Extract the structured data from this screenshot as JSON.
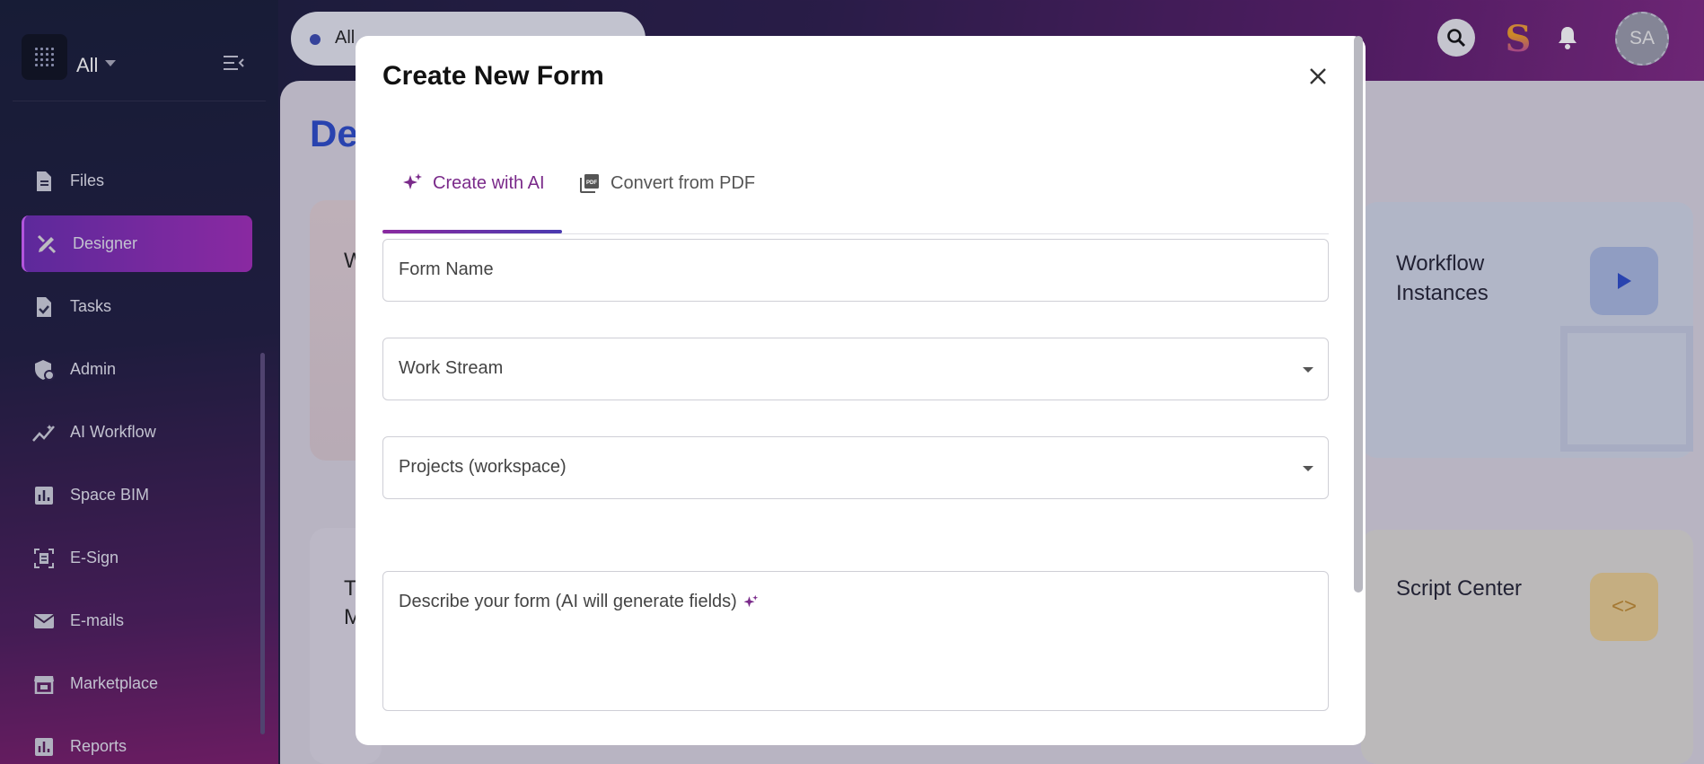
{
  "sidebar": {
    "app_selector_label": "All",
    "items": [
      {
        "label": "Files",
        "icon": "file-icon",
        "active": false
      },
      {
        "label": "Designer",
        "icon": "designer-tools-icon",
        "active": true
      },
      {
        "label": "Tasks",
        "icon": "task-check-icon",
        "active": false
      },
      {
        "label": "Admin",
        "icon": "admin-shield-icon",
        "active": false
      },
      {
        "label": "AI Workflow",
        "icon": "ai-workflow-icon",
        "active": false
      },
      {
        "label": "Space BIM",
        "icon": "bar-chart-icon",
        "active": false
      },
      {
        "label": "E-Sign",
        "icon": "esign-icon",
        "active": false
      },
      {
        "label": "E-mails",
        "icon": "mail-icon",
        "active": false
      },
      {
        "label": "Marketplace",
        "icon": "store-icon",
        "active": false
      },
      {
        "label": "Reports",
        "icon": "report-chart-icon",
        "active": false
      }
    ]
  },
  "topbar": {
    "scope_label": "All",
    "avatar_initials": "SA",
    "brand_glyph": "S"
  },
  "main": {
    "page_title_partial": "De",
    "cards": {
      "workflow_instances_label": "Workflow\nInstances",
      "script_center_label": "Script Center",
      "partial_a": "W",
      "partial_b": "T\nM"
    }
  },
  "modal": {
    "title": "Create New Form",
    "tabs": [
      {
        "label": "Create with AI",
        "icon": "sparkle-icon",
        "active": true
      },
      {
        "label": "Convert from PDF",
        "icon": "pdf-icon",
        "active": false
      }
    ],
    "fields": {
      "form_name": "Form Name",
      "work_stream": "Work Stream",
      "projects": "Projects (workspace)",
      "description": "Describe your form (AI will generate fields)"
    }
  },
  "colors": {
    "accent_purple": "#7a2a8a",
    "active_nav": "#a02ab8",
    "title_blue": "#2a4ac8"
  }
}
